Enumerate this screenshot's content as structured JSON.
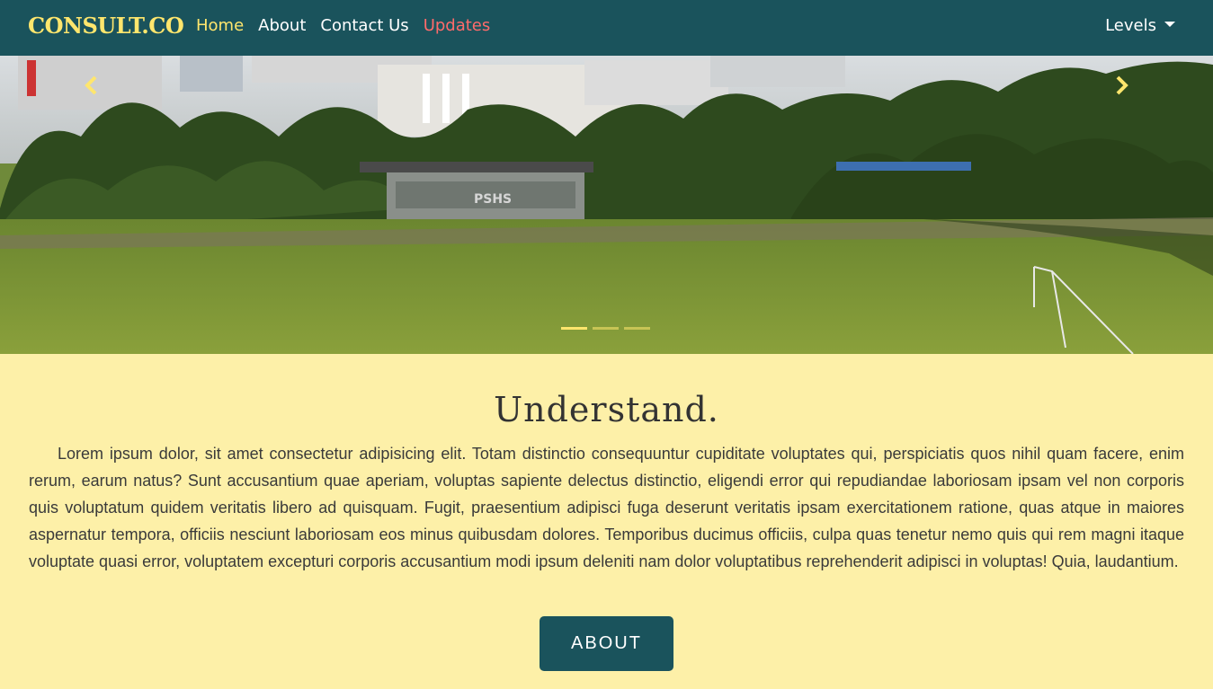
{
  "navbar": {
    "brand": "CONSULT.CO",
    "links": [
      {
        "label": "Home",
        "state": "active"
      },
      {
        "label": "About"
      },
      {
        "label": "Contact Us"
      },
      {
        "label": "Updates",
        "state": "highlighted"
      }
    ],
    "dropdown_label": "Levels"
  },
  "hero": {
    "slide_text": "PSHS",
    "prev_icon": "chevron-left-icon",
    "next_icon": "chevron-right-icon",
    "slide_count": 3,
    "active_slide": 1
  },
  "main": {
    "title": "Understand.",
    "body": "Lorem ipsum dolor, sit amet consectetur adipisicing elit. Totam distinctio consequuntur cupiditate voluptates qui, perspiciatis quos nihil quam facere, enim rerum, earum natus? Sunt accusantium quae aperiam, voluptas sapiente delectus distinctio, eligendi error qui repudiandae laboriosam ipsam vel non corporis quis voluptatum quidem veritatis libero ad quisquam. Fugit, praesentium adipisci fuga deserunt veritatis ipsam exercitationem ratione, quas atque in maiores aspernatur tempora, officiis nesciunt laboriosam eos minus quibusdam dolores. Temporibus ducimus officiis, culpa quas tenetur nemo quis qui rem magni itaque voluptate quasi error, voluptatem excepturi corporis accusantium modi ipsum deleniti nam dolor voluptatibus reprehenderit adipisci in voluptas! Quia, laudantium.",
    "button_label": "ABOUT"
  },
  "colors": {
    "navbar_bg": "#1a535c",
    "brand": "#ffe66d",
    "active_link": "#ffe66d",
    "highlight_link": "#ff6b6b",
    "page_bg": "#fdf0a8",
    "button_bg": "#1a535c"
  }
}
